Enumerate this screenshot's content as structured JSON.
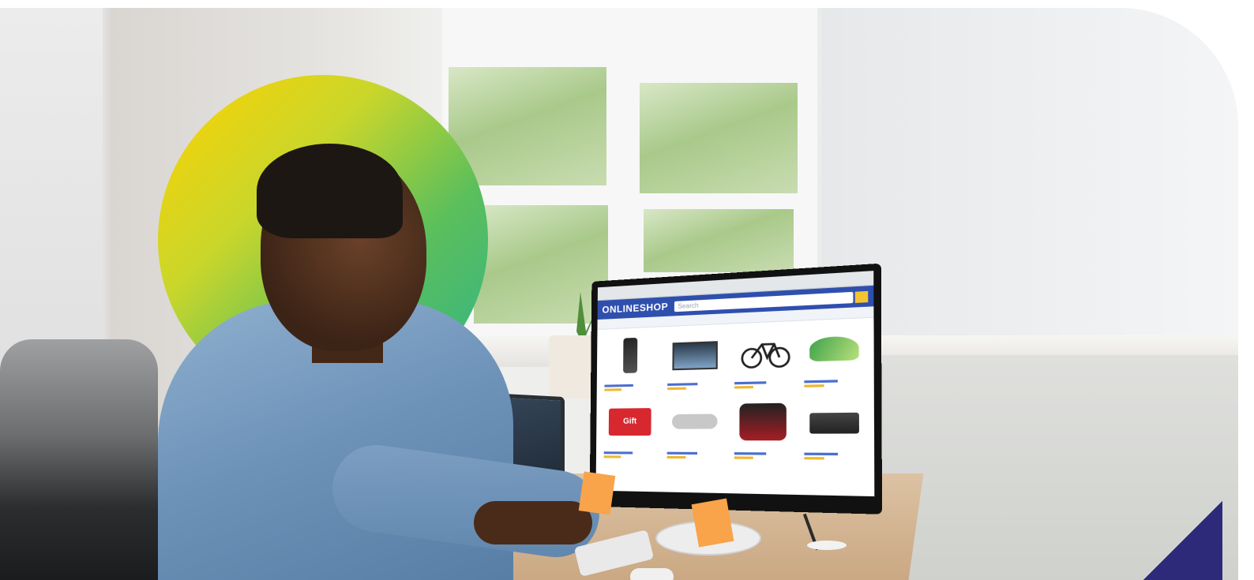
{
  "scene": {
    "description_free": true
  },
  "monitor": {
    "shop_name": "ONLINESHOP",
    "search_placeholder": "Search",
    "gift_text": "Gift"
  },
  "colors": {
    "circle_start": "#ffd200",
    "circle_end": "#2fb38a",
    "shop_header": "#2f4fae",
    "accent_corner": "#2d2a7a"
  }
}
